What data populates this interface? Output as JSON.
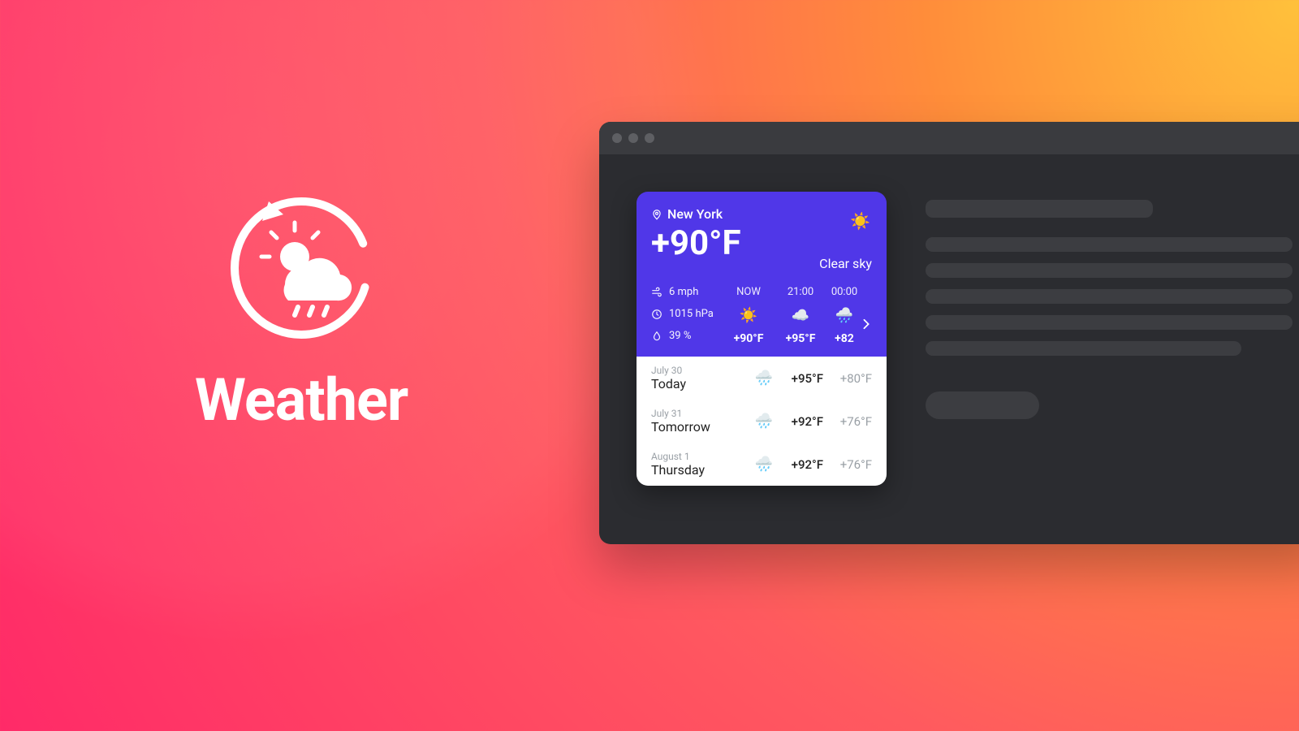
{
  "hero": {
    "title": "Weather"
  },
  "card": {
    "location": "New York",
    "temperature": "+90°F",
    "condition": "Clear sky",
    "condition_icon": "sun",
    "wind": "6 mph",
    "pressure": "1015 hPa",
    "humidity": "39 %",
    "hourly": [
      {
        "time": "NOW",
        "icon": "sun",
        "temp": "+90°F"
      },
      {
        "time": "21:00",
        "icon": "cloud",
        "temp": "+95°F"
      },
      {
        "time": "00:00",
        "icon": "rain",
        "temp": "+82"
      }
    ],
    "days": [
      {
        "date": "July 30",
        "name": "Today",
        "icon": "rain",
        "hi": "+95°F",
        "lo": "+80°F"
      },
      {
        "date": "July 31",
        "name": "Tomorrow",
        "icon": "rain",
        "hi": "+92°F",
        "lo": "+76°F"
      },
      {
        "date": "August 1",
        "name": "Thursday",
        "icon": "rain",
        "hi": "+92°F",
        "lo": "+76°F"
      }
    ]
  },
  "colors": {
    "card_accent": "#5037e8"
  }
}
